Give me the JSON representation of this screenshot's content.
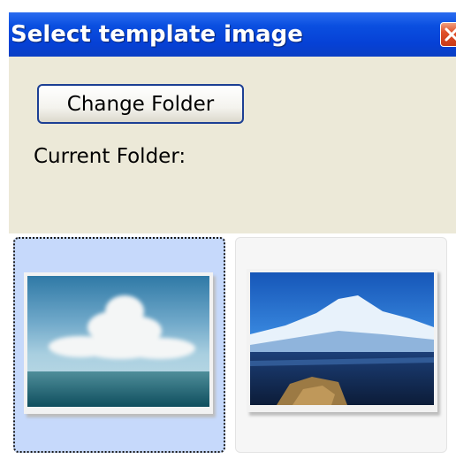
{
  "window": {
    "title": "Select template image",
    "close_icon": "close-icon"
  },
  "toolbar": {
    "change_folder_label": "Change Folder",
    "current_folder_label": "Current Folder:"
  },
  "thumbnails": [
    {
      "image": "cloud-sky-ocean-image",
      "selected": true
    },
    {
      "image": "snow-mountain-image",
      "selected": false
    }
  ],
  "colors": {
    "titlebar": "#0a4fe0",
    "panel": "#ece9d8",
    "selection": "#c6d9fb",
    "close": "#e0502a"
  }
}
